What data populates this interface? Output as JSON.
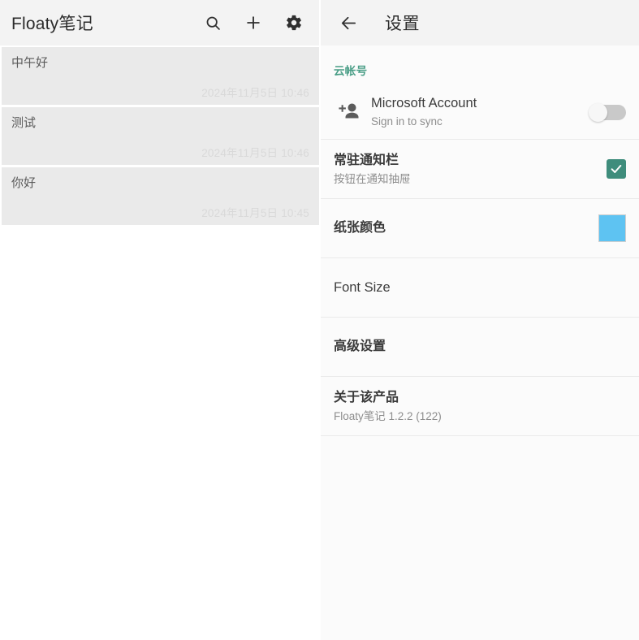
{
  "notes_pane": {
    "appbar": {
      "title": "Floaty笔记",
      "actions": [
        {
          "name": "search-icon",
          "label": "搜索"
        },
        {
          "name": "add-icon",
          "label": "新建"
        },
        {
          "name": "gear-icon",
          "label": "设置"
        }
      ]
    },
    "notes": [
      {
        "title": "中午好",
        "time": "2024年11月5日 10:46"
      },
      {
        "title": "测试",
        "time": "2024年11月5日 10:46"
      },
      {
        "title": "你好",
        "time": "2024年11月5日 10:45"
      }
    ]
  },
  "settings_pane": {
    "appbar": {
      "back_icon": "arrow-left-icon",
      "title": "设置"
    },
    "section_cloud_account": "云帐号",
    "rows": [
      {
        "id": "microsoft-account",
        "icon": "person-add-icon",
        "title": "Microsoft Account",
        "subtitle": "Sign in to sync",
        "control": "toggle",
        "toggle_on": false
      },
      {
        "id": "persistent-notification",
        "title": "常驻通知栏",
        "subtitle": "按钮在通知抽屉",
        "control": "checkbox",
        "checked": true
      },
      {
        "id": "paper-color",
        "title": "纸张颜色",
        "control": "color-swatch",
        "color": "#5ec3f2"
      },
      {
        "id": "font-size",
        "title": "Font Size",
        "control": "none"
      },
      {
        "id": "advanced-settings",
        "title": "高级设置",
        "control": "none"
      },
      {
        "id": "about",
        "title": "关于该产品",
        "subtitle": "Floaty笔记 1.2.2 (122)",
        "control": "none"
      }
    ]
  },
  "colors": {
    "accent_teal": "#4a9e87",
    "checkbox_teal": "#3f8d7c",
    "paper_blue": "#5ec3f2",
    "appbar_bg": "#f3f3f3",
    "note_card_bg": "#eaeaea"
  }
}
